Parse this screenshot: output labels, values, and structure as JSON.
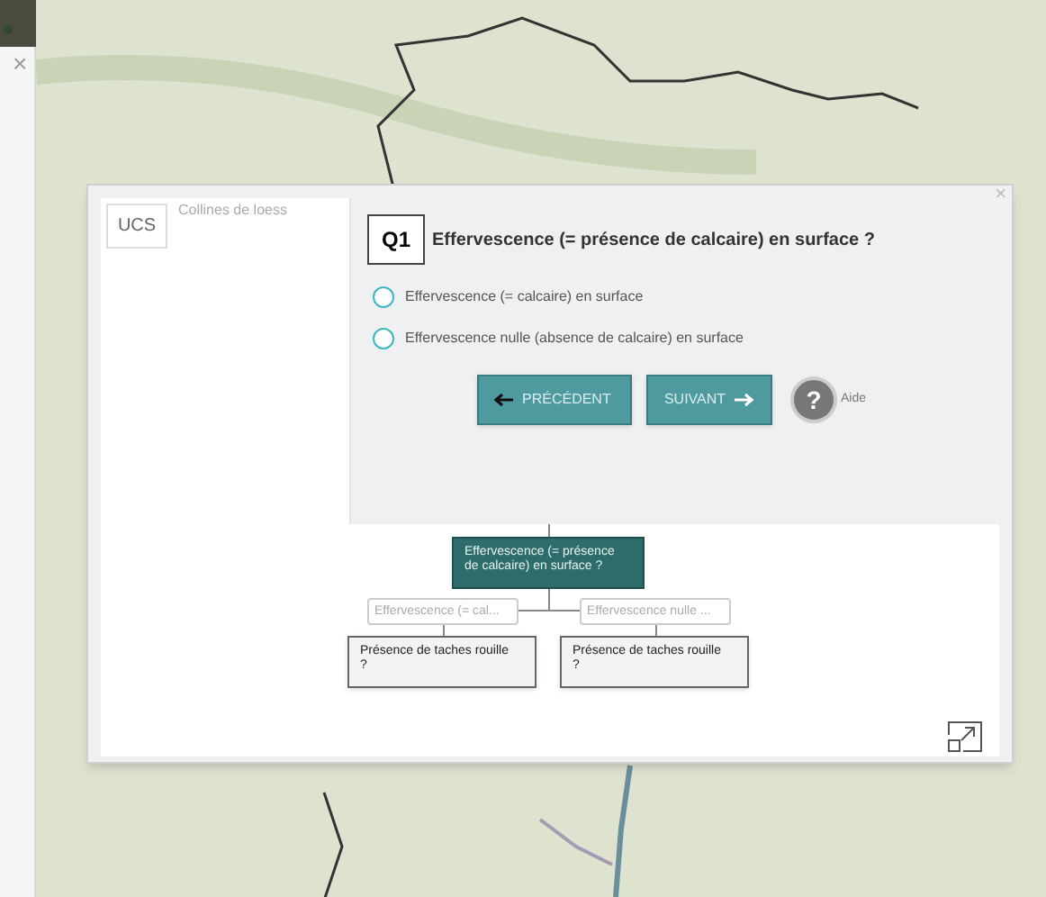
{
  "sidebar": {
    "close": "×"
  },
  "modal": {
    "close": "×",
    "ucs": {
      "badge": "UCS",
      "name": "Collines de loess"
    },
    "question": {
      "number": "Q1",
      "text": "Effervescence (= présence de calcaire) en surface ?"
    },
    "options": [
      {
        "label": "Effervescence (= calcaire) en surface",
        "selected": false
      },
      {
        "label": "Effervescence nulle (absence de calcaire) en surface",
        "selected": false
      }
    ],
    "buttons": [
      {
        "kind": "prev",
        "label": "PRÉCÉDENT"
      },
      {
        "kind": "next",
        "label": "SUIVANT"
      }
    ],
    "help": {
      "icon": "?",
      "label": "Aide"
    },
    "tree": {
      "label": "Effervescence (= présence de calcaire) en surface ?",
      "children": [
        {
          "label": "Effervescence (= cal...",
          "children": [
            {
              "label": "Présence de taches rouille ?"
            }
          ]
        },
        {
          "label": "Effervescence nulle ...",
          "children": [
            {
              "label": "Présence de taches rouille ?"
            }
          ]
        }
      ]
    }
  }
}
